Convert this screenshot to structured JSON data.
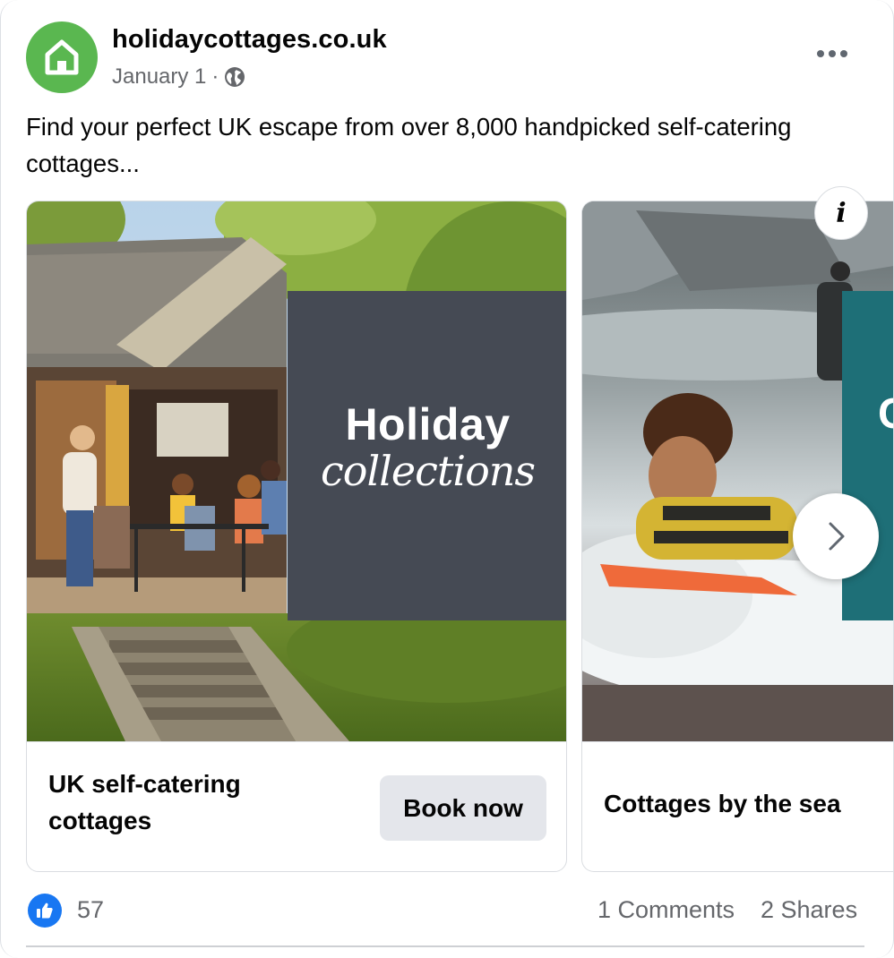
{
  "post": {
    "page_name": "holidaycottages.co.uk",
    "date": "January 1",
    "separator": "·",
    "text": "Find your perfect UK escape from over 8,000 handpicked self-catering cottages..."
  },
  "carousel": {
    "cards": [
      {
        "title": "UK self-catering cottages",
        "button_label": "Book now",
        "overlay_line1": "Holiday",
        "overlay_line2": "collections"
      },
      {
        "title": "Cottages by the sea"
      }
    ]
  },
  "engagement": {
    "like_count": "57",
    "comments": "1 Comments",
    "shares": "2 Shares"
  },
  "icons": {
    "avatar": "house-logo-icon",
    "audience": "globe-icon",
    "more": "more-dots-icon",
    "info": "info-icon",
    "next": "chevron-right-icon",
    "like": "thumbs-up-icon"
  },
  "colors": {
    "brand_green": "#5ab750",
    "panel_gray": "#454a54",
    "panel_teal": "#1e6f77",
    "like_blue": "#1877f2"
  }
}
